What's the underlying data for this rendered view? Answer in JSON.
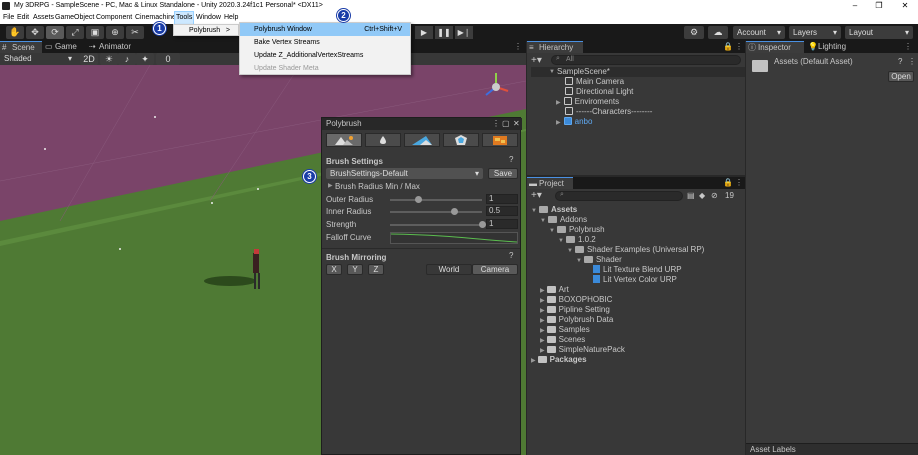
{
  "window": {
    "title": "My 3DRPG - SampleScene - PC, Mac & Linux Standalone - Unity 2020.3.24f1c1 Personal* <DX11>",
    "minimize": "–",
    "maximize": "❐",
    "close": "✕"
  },
  "menubar": [
    "File",
    "Edit",
    "Assets",
    "GameObject",
    "Component",
    "Cinemachine",
    "Tools",
    "Window",
    "Help"
  ],
  "tools_menu": {
    "items": [
      {
        "label": "Polybrush",
        "arrow": ">"
      }
    ]
  },
  "polybrush_submenu": {
    "items": [
      {
        "label": "Polybrush Window",
        "shortcut": "Ctrl+Shift+V",
        "highlighted": true
      },
      {
        "label": "Bake Vertex Streams"
      },
      {
        "label": "Update Z_AdditionalVertexStreams"
      },
      {
        "label": "Update Shader Meta",
        "disabled": true
      }
    ]
  },
  "badges": [
    "1",
    "2",
    "3"
  ],
  "toolbar": {
    "tools": [
      "✋",
      "✥",
      "⟳",
      "⤢",
      "▣",
      "⊕",
      "✂"
    ],
    "account": "Account",
    "layers": "Layers",
    "layout": "Layout",
    "play": "▶",
    "pause": "❚❚",
    "step": "▶❘"
  },
  "scene_tabs": {
    "scene": "Scene",
    "game": "Game",
    "animator": "Animator"
  },
  "scene_bar": {
    "shading": "Shaded",
    "mode2d": "2D",
    "zero": "0"
  },
  "hierarchy": {
    "tab": "Hierarchy",
    "search_placeholder": "All",
    "scene": "SampleScene*",
    "items": [
      "Main Camera",
      "Directional Light",
      "Enviroments",
      "------Characters--------",
      "anbo"
    ]
  },
  "project": {
    "tab": "Project",
    "count": "19",
    "tree": [
      {
        "label": "Assets",
        "bold": true,
        "depth": 0,
        "open": true
      },
      {
        "label": "Addons",
        "depth": 1,
        "open": true
      },
      {
        "label": "Polybrush",
        "depth": 2,
        "open": true
      },
      {
        "label": "1.0.2",
        "depth": 3,
        "open": true
      },
      {
        "label": "Shader Examples (Universal RP)",
        "depth": 4,
        "open": true
      },
      {
        "label": "Shader",
        "depth": 5,
        "open": true
      },
      {
        "label": "Lit Texture Blend URP",
        "depth": 6,
        "kind": "shader"
      },
      {
        "label": "Lit Vertex Color URP",
        "depth": 6,
        "kind": "shader"
      },
      {
        "label": "Art",
        "depth": 1
      },
      {
        "label": "BOXOPHOBIC",
        "depth": 1
      },
      {
        "label": "Pipline Setting",
        "depth": 1
      },
      {
        "label": "Polybrush Data",
        "depth": 1
      },
      {
        "label": "Samples",
        "depth": 1
      },
      {
        "label": "Scenes",
        "depth": 1
      },
      {
        "label": "SimpleNaturePack",
        "depth": 1
      },
      {
        "label": "Packages",
        "bold": true,
        "depth": 0
      }
    ]
  },
  "inspector": {
    "tab": "Inspector",
    "lighting_tab": "Lighting",
    "asset_title": "Assets (Default Asset)",
    "open_button": "Open",
    "asset_labels": "Asset Labels"
  },
  "polybrush": {
    "title": "Polybrush",
    "brush_settings": "Brush Settings",
    "preset": "BrushSettings-Default",
    "save": "Save",
    "radius_toggle": "Brush Radius Min / Max",
    "outer_radius_label": "Outer Radius",
    "outer_radius": "1",
    "inner_radius_label": "Inner Radius",
    "inner_radius": "0.5",
    "strength_label": "Strength",
    "strength": "1",
    "falloff_label": "Falloff Curve",
    "mirroring": "Brush Mirroring",
    "axes": [
      "X",
      "Y",
      "Z"
    ],
    "world": "World",
    "camera": "Camera",
    "help": "?"
  },
  "sliders": {
    "outer_radius": 0.3,
    "inner_radius": 0.7,
    "strength": 1.0
  },
  "colors": {
    "sky": "#7a4469",
    "ground": "#4f7a34",
    "accent": "#4a90e2",
    "menu_highlight": "#91c9f7",
    "badge": "#1a3da8"
  }
}
